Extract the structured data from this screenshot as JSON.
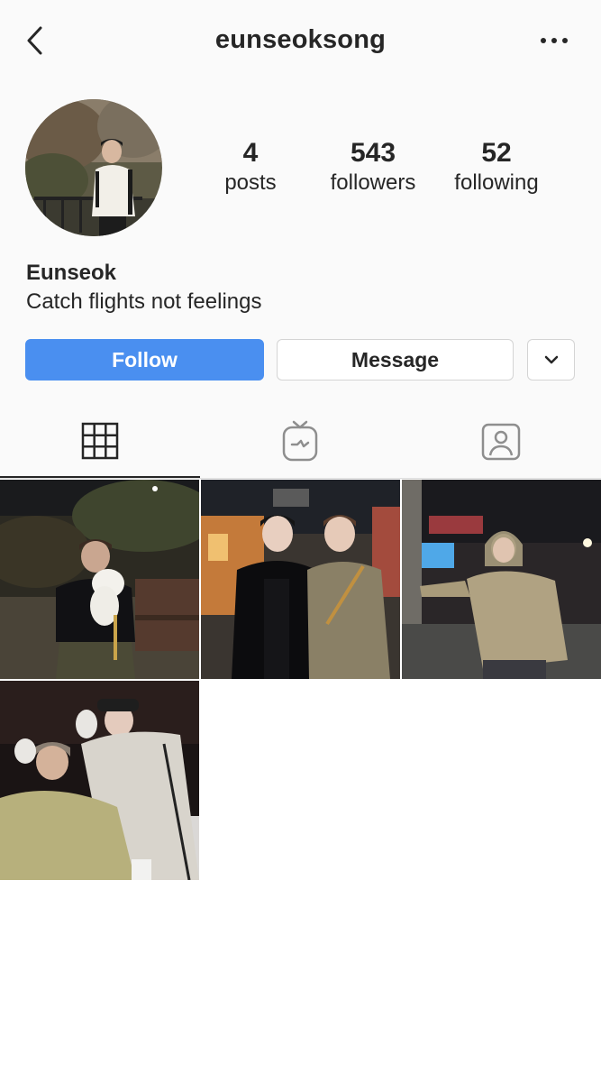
{
  "header": {
    "username": "eunseoksong",
    "back_icon": "chevron-left-icon",
    "more_icon": "more-horizontal-icon"
  },
  "profile": {
    "posts_count": "4",
    "posts_label": "posts",
    "followers_count": "543",
    "followers_label": "followers",
    "following_count": "52",
    "following_label": "following",
    "display_name": "Eunseok",
    "bio": "Catch flights not feelings"
  },
  "actions": {
    "follow_label": "Follow",
    "message_label": "Message",
    "dropdown_icon": "chevron-down-icon"
  },
  "tabs": [
    {
      "name": "grid",
      "icon": "grid-icon",
      "active": true
    },
    {
      "name": "igtv",
      "icon": "igtv-icon",
      "active": false
    },
    {
      "name": "tagged",
      "icon": "tagged-user-icon",
      "active": false
    }
  ],
  "posts": [
    {
      "id": 1
    },
    {
      "id": 2
    },
    {
      "id": 3
    },
    {
      "id": 4
    }
  ],
  "colors": {
    "follow_button": "#4a8ff0",
    "text": "#262626",
    "divider": "#dbdbdb"
  }
}
